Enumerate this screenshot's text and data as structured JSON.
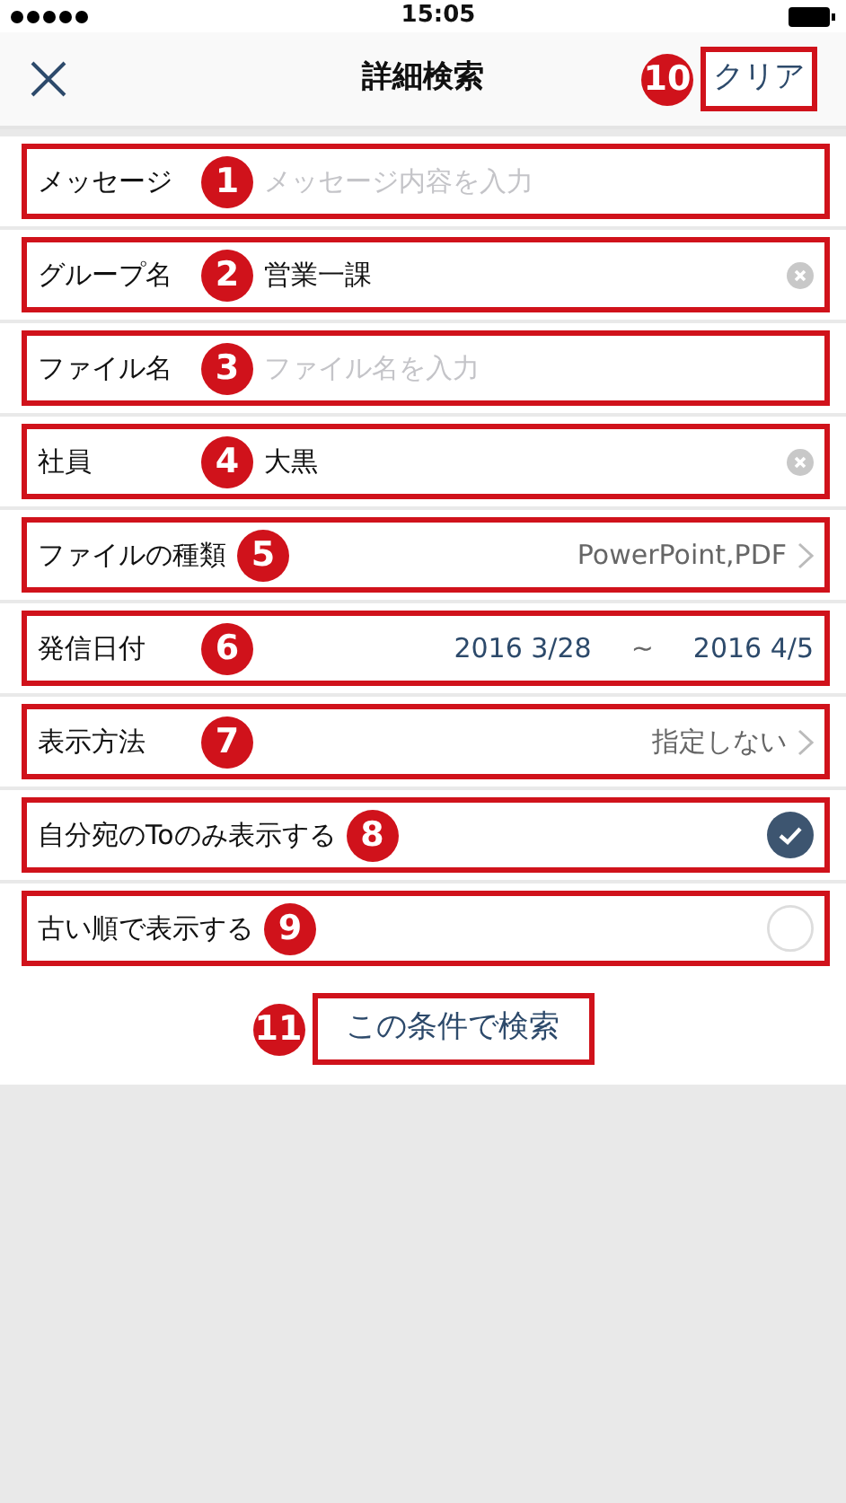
{
  "status_bar": {
    "time": "15:05"
  },
  "nav": {
    "title": "詳細検索",
    "clear_button": "クリア",
    "clear_callout": "10"
  },
  "rows": [
    {
      "kind": "text",
      "label": "メッセージ",
      "callout": "1",
      "placeholder": "メッセージ内容を入力"
    },
    {
      "kind": "text",
      "label": "グループ名",
      "callout": "2",
      "value": "営業一課"
    },
    {
      "kind": "text",
      "label": "ファイル名",
      "callout": "3",
      "placeholder": "ファイル名を入力"
    },
    {
      "kind": "text",
      "label": "社員",
      "callout": "4",
      "value": "大黒"
    },
    {
      "kind": "select",
      "label": "ファイルの種類",
      "callout": "5",
      "value": "PowerPoint,PDF"
    },
    {
      "kind": "date",
      "label": "発信日付",
      "callout": "6",
      "from": "2016 3/28",
      "separator": "~",
      "to": "2016 4/5"
    },
    {
      "kind": "select",
      "label": "表示方法",
      "callout": "7",
      "value": "指定しない"
    },
    {
      "kind": "toggle",
      "label": "自分宛のToのみ表示する",
      "callout": "8",
      "checked": true
    },
    {
      "kind": "toggle",
      "label": "古い順で表示する",
      "callout": "9",
      "checked": false
    }
  ],
  "search_button": {
    "label": "この条件で検索",
    "callout": "11"
  }
}
